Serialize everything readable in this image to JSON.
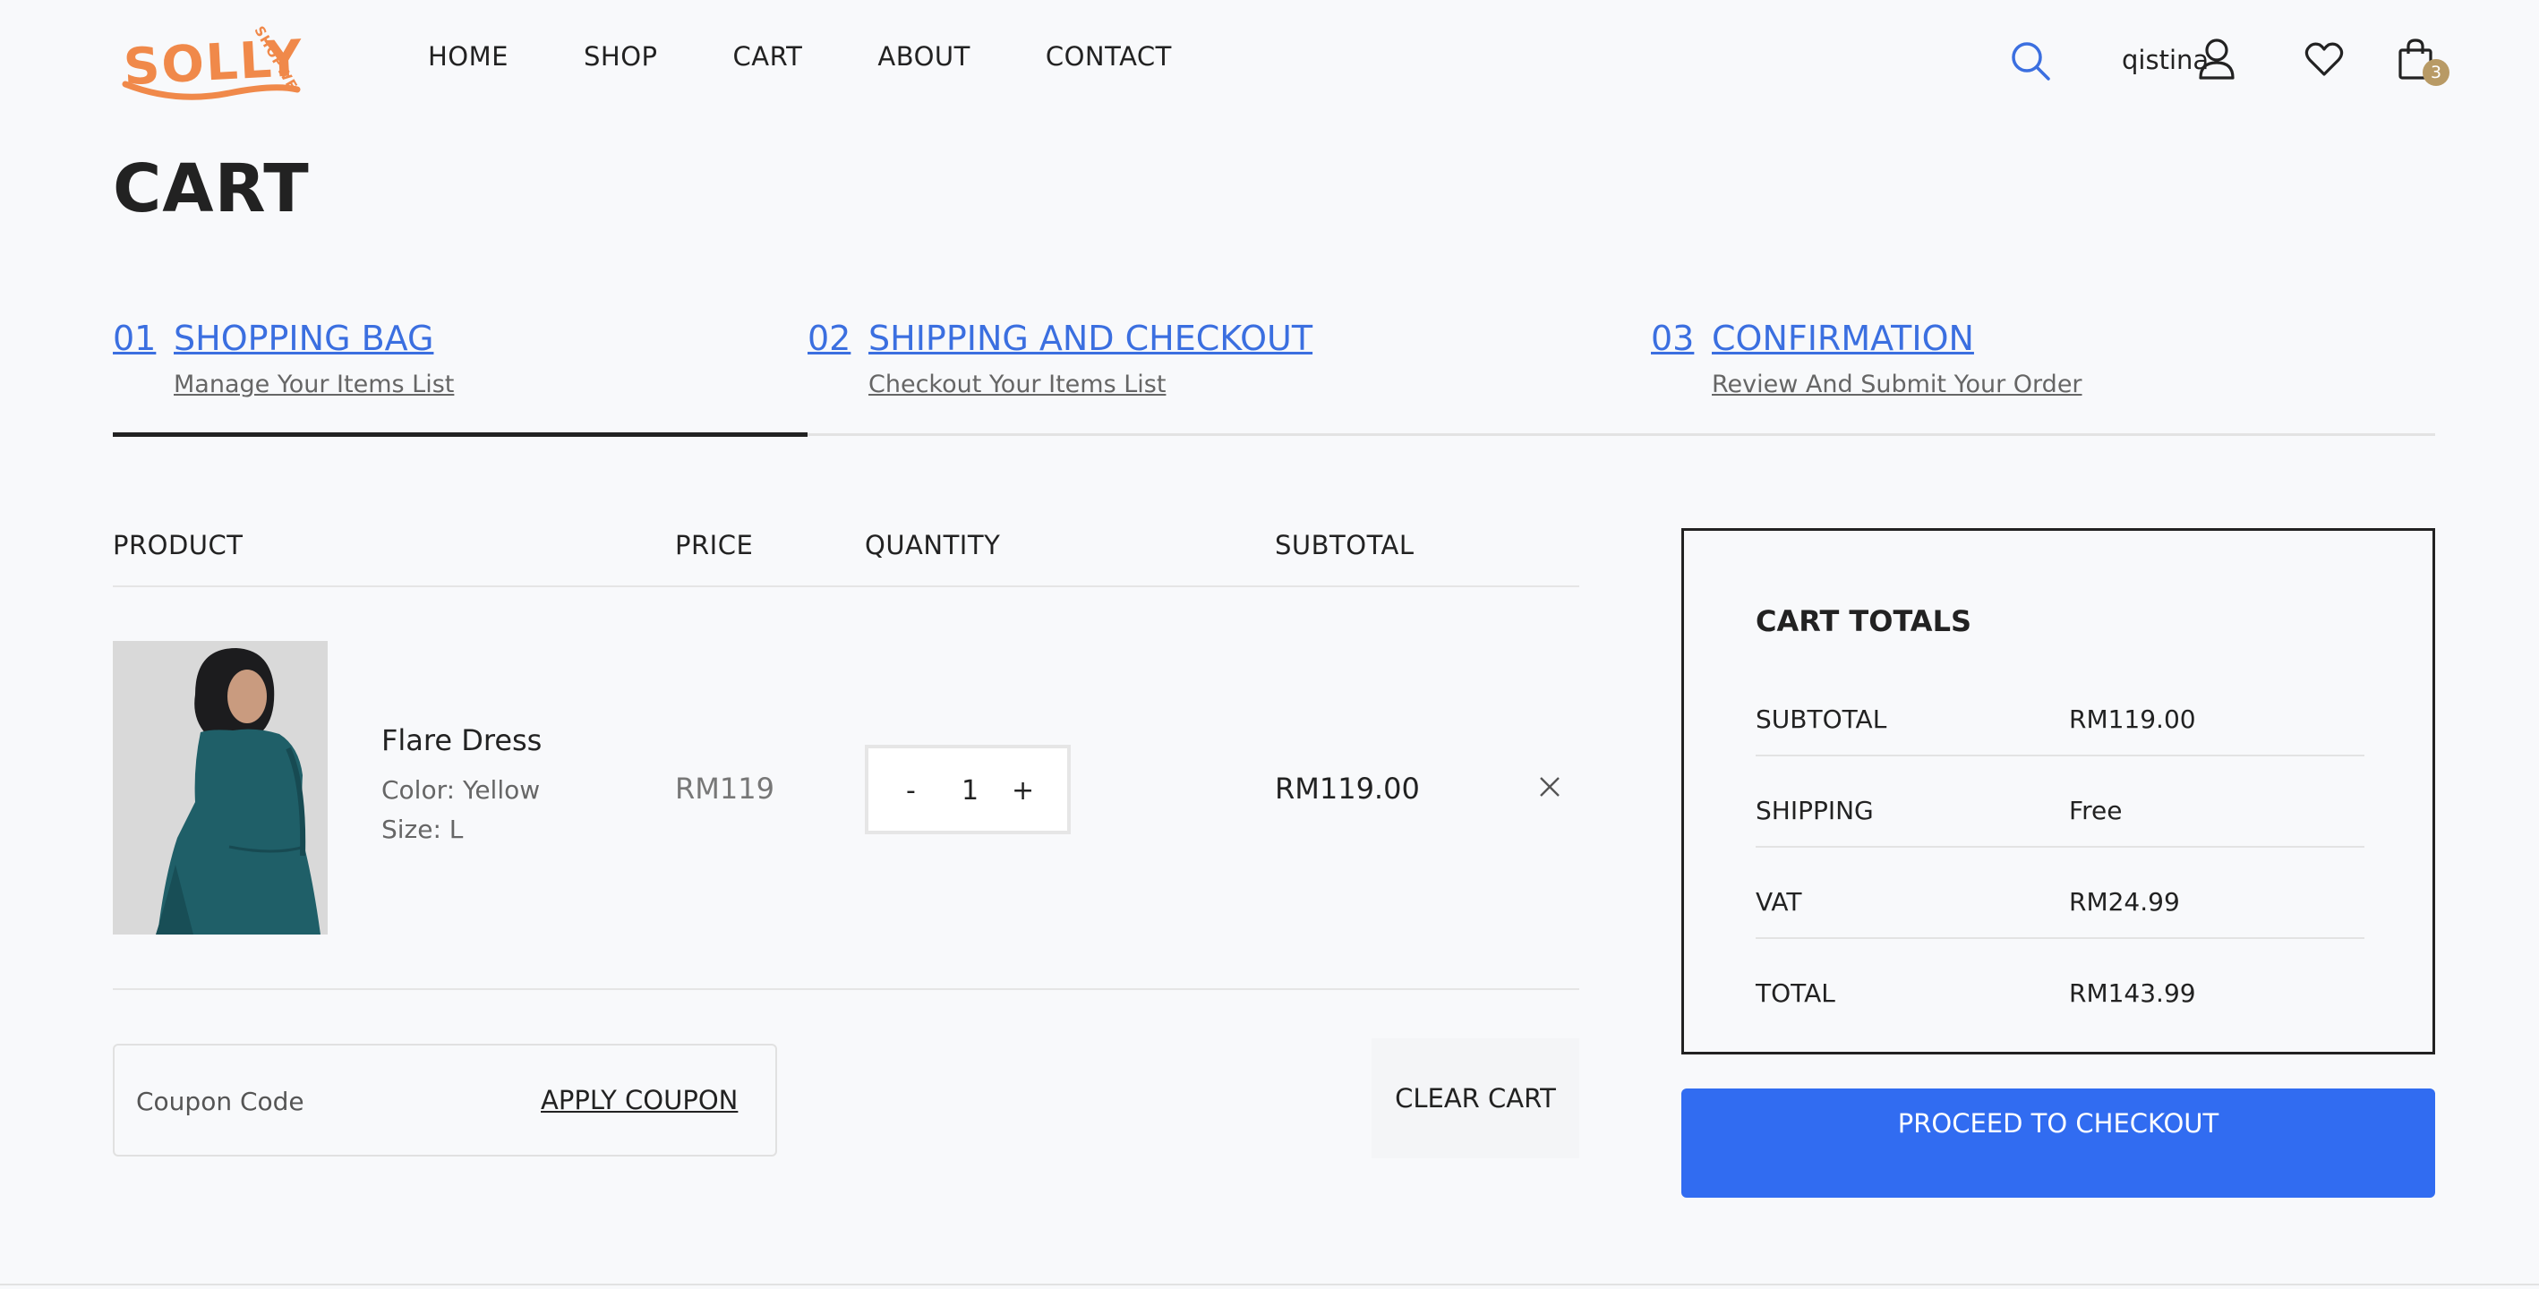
{
  "header": {
    "logo_text": "SOLLY",
    "logo_subtext": "SHOPWE",
    "nav": [
      "HOME",
      "SHOP",
      "CART",
      "ABOUT",
      "CONTACT"
    ],
    "user_name": "qistina",
    "cart_count": "3"
  },
  "page": {
    "title": "CART"
  },
  "steps": [
    {
      "num": "01",
      "title": "SHOPPING BAG",
      "subtitle": "Manage Your Items List"
    },
    {
      "num": "02",
      "title": "SHIPPING AND CHECKOUT",
      "subtitle": "Checkout Your Items List"
    },
    {
      "num": "03",
      "title": "CONFIRMATION",
      "subtitle": "Review And Submit Your Order"
    }
  ],
  "table": {
    "headers": [
      "PRODUCT",
      "PRICE",
      "QUANTITY",
      "SUBTOTAL"
    ],
    "items": [
      {
        "name": "Flare Dress",
        "color": "Color: Yellow",
        "size": "Size: L",
        "price": "RM119",
        "qty_minus": "-",
        "quantity": "1",
        "qty_plus": "+",
        "subtotal": "RM119.00"
      }
    ]
  },
  "coupon": {
    "placeholder": "Coupon Code",
    "apply_label": "APPLY COUPON"
  },
  "clear_cart_label": "CLEAR CART",
  "totals": {
    "title": "CART TOTALS",
    "rows": [
      {
        "label": "SUBTOTAL",
        "value": "RM119.00"
      },
      {
        "label": "SHIPPING",
        "value": "Free"
      },
      {
        "label": "VAT",
        "value": "RM24.99"
      },
      {
        "label": "TOTAL",
        "value": "RM143.99"
      }
    ]
  },
  "checkout_label": "PROCEED TO CHECKOUT",
  "colors": {
    "accent": "#316cf1",
    "link": "#3b6fe0",
    "logo": "#f0894a",
    "badge": "#b89a65"
  }
}
